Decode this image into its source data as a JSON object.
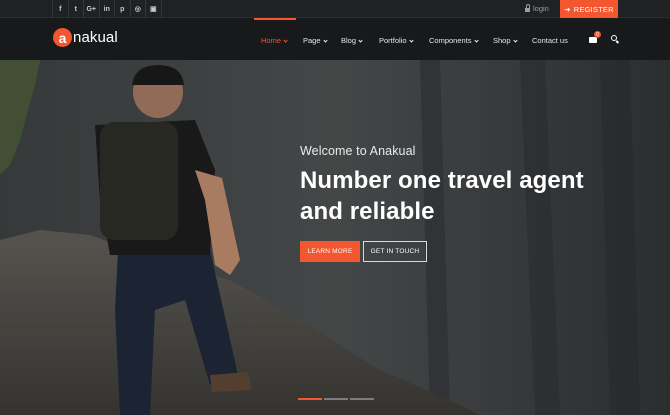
{
  "topbar": {
    "social": [
      {
        "icon": "facebook-icon",
        "glyph": "f"
      },
      {
        "icon": "twitter-icon",
        "glyph": "t"
      },
      {
        "icon": "google-plus-icon",
        "glyph": "G+"
      },
      {
        "icon": "linkedin-icon",
        "glyph": "in"
      },
      {
        "icon": "pinterest-icon",
        "glyph": "p"
      },
      {
        "icon": "dribbble-icon",
        "glyph": "◎"
      },
      {
        "icon": "instagram-icon",
        "glyph": "▣"
      }
    ],
    "login_label": "login",
    "register_label": "REGISTER"
  },
  "brand": {
    "mark": "a",
    "name": "nakual",
    "accent": "#f4562f"
  },
  "nav": {
    "items": [
      {
        "label": "Home",
        "has_caret": true,
        "active": true
      },
      {
        "label": "Page",
        "has_caret": true,
        "active": false
      },
      {
        "label": "Blog",
        "has_caret": true,
        "active": false
      },
      {
        "label": "Portfolio",
        "has_caret": true,
        "active": false
      },
      {
        "label": "Components",
        "has_caret": true,
        "active": false
      },
      {
        "label": "Shop",
        "has_caret": true,
        "active": false
      },
      {
        "label": "Contact us",
        "has_caret": false,
        "active": false
      }
    ],
    "cart_count": "0"
  },
  "hero": {
    "welcome": "Welcome to Anakual",
    "headline": "Number one travel agent and reliable",
    "primary_button": "LEARN MORE",
    "secondary_button": "GET IN TOUCH",
    "slide_count": 3,
    "active_slide": 1
  }
}
